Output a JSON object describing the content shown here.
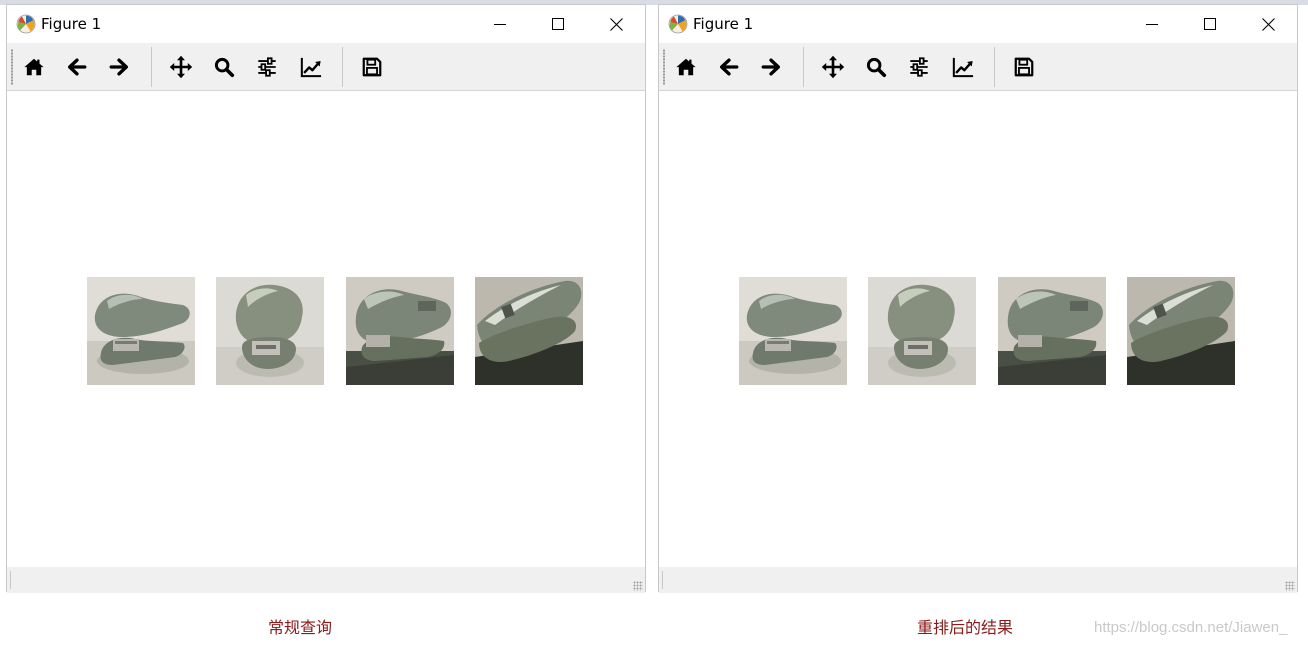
{
  "windows": [
    {
      "title": "Figure 1",
      "caption": "常规查询",
      "images": [
        {
          "name": "stapler-side-view",
          "variant": "a"
        },
        {
          "name": "stapler-front-view",
          "variant": "b"
        },
        {
          "name": "stapler-side-view-dark-background",
          "variant": "c"
        },
        {
          "name": "stapler-rotated-view",
          "variant": "d"
        }
      ]
    },
    {
      "title": "Figure 1",
      "caption": "重排后的结果",
      "images": [
        {
          "name": "stapler-side-view",
          "variant": "a"
        },
        {
          "name": "stapler-front-view",
          "variant": "b"
        },
        {
          "name": "stapler-side-view-dark-background",
          "variant": "c"
        },
        {
          "name": "stapler-rotated-view",
          "variant": "d"
        }
      ]
    }
  ],
  "toolbar_buttons": [
    {
      "name": "home",
      "icon": "home-icon"
    },
    {
      "name": "back",
      "icon": "arrow-left-icon"
    },
    {
      "name": "forward",
      "icon": "arrow-right-icon"
    },
    {
      "name": "pan",
      "icon": "move-arrows-icon"
    },
    {
      "name": "zoom",
      "icon": "magnifier-icon"
    },
    {
      "name": "subplots",
      "icon": "sliders-icon"
    },
    {
      "name": "edit-axes",
      "icon": "line-chart-icon"
    },
    {
      "name": "save",
      "icon": "floppy-disk-icon"
    }
  ],
  "window_controls": [
    "minimize-icon",
    "maximize-icon",
    "close-icon"
  ],
  "watermark": "https://blog.csdn.net/Jiawen_",
  "colors": {
    "caption": "#8b1a1a",
    "toolbar_bg": "#f0f0f0",
    "icon": "#000000",
    "stapler_body": "#7e8a7c",
    "paper": "#e3e1db"
  }
}
